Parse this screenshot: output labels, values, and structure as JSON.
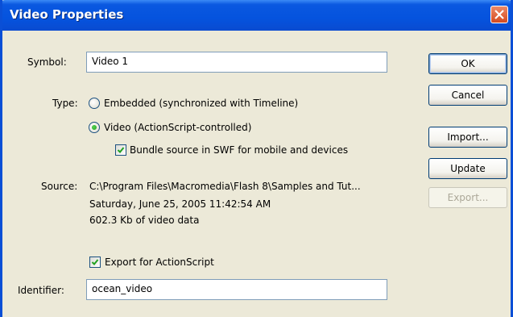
{
  "window": {
    "title": "Video Properties",
    "icon": "close-icon"
  },
  "form": {
    "symbol_label": "Symbol:",
    "symbol_value": "Video 1",
    "type_label": "Type:",
    "radio_embedded_label": "Embedded (synchronized with Timeline)",
    "radio_embedded_checked": false,
    "radio_video_label": "Video (ActionScript-controlled)",
    "radio_video_checked": true,
    "bundle_label": "Bundle source in SWF for mobile and devices",
    "bundle_checked": true,
    "source_label": "Source:",
    "source_path": "C:\\Program Files\\Macromedia\\Flash 8\\Samples and Tut...",
    "source_date": "Saturday, June 25, 2005  11:42:54 AM",
    "source_size": "602.3 Kb of video data",
    "export_label": "Export for ActionScript",
    "export_checked": true,
    "identifier_label": "Identifier:",
    "identifier_value": "ocean_video"
  },
  "buttons": {
    "ok": "OK",
    "cancel": "Cancel",
    "import": "Import...",
    "update": "Update",
    "export": "Export..."
  },
  "colors": {
    "titlebar": "#0553de",
    "face": "#ece9d8",
    "radio_dot": "#21a121",
    "check": "#21a121"
  }
}
